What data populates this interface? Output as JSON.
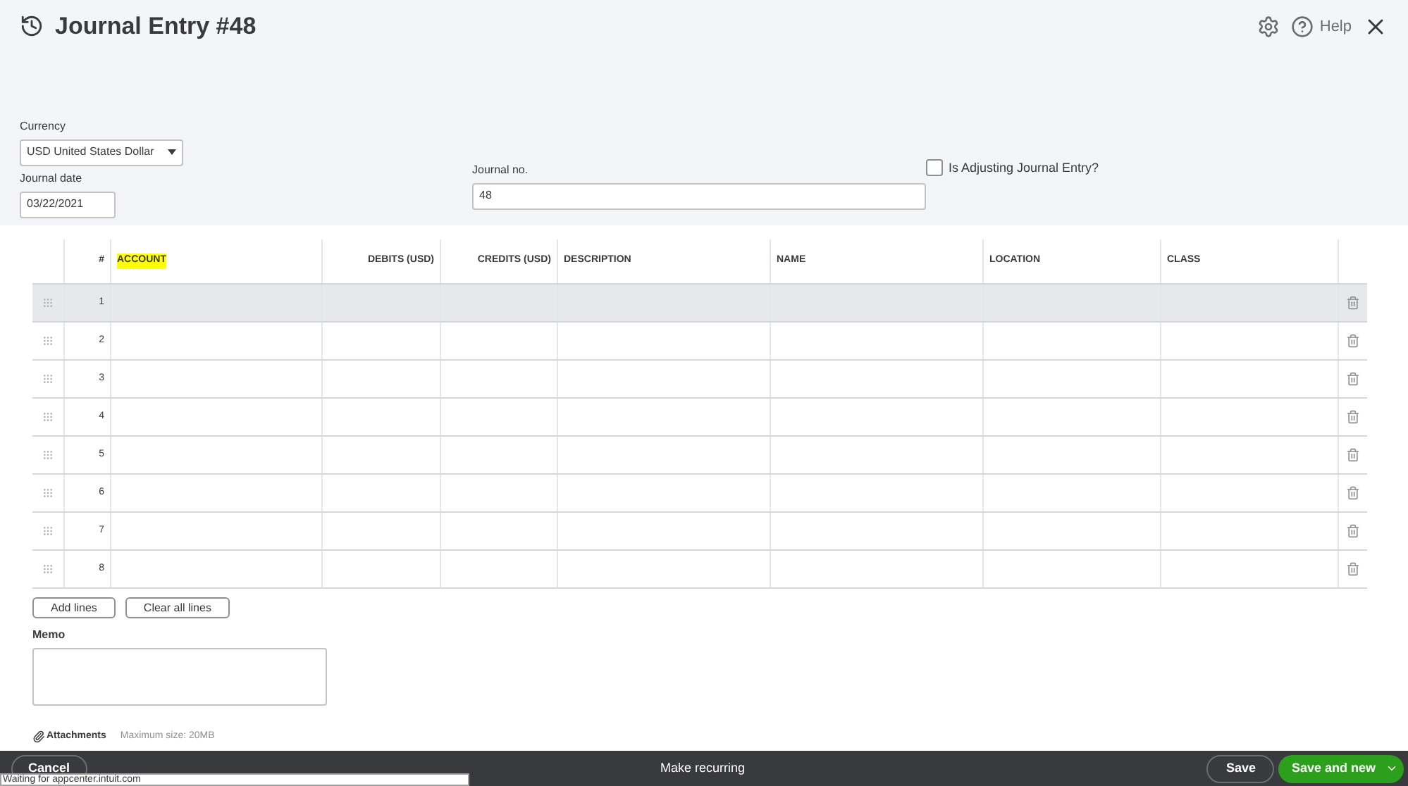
{
  "header": {
    "title": "Journal Entry #48",
    "help": "Help"
  },
  "form": {
    "currency_label": "Currency",
    "currency": "USD United States Dollar",
    "date_label": "Journal date",
    "date": "03/22/2021",
    "journal_no_label": "Journal no.",
    "journal_no": "48",
    "adjusting_label": "Is Adjusting Journal Entry?",
    "adjusting_checked": false
  },
  "table": {
    "columns": [
      {
        "label": "#",
        "highlight": false
      },
      {
        "label": "ACCOUNT",
        "highlight": true
      },
      {
        "label": "DEBITS (USD)",
        "highlight": false
      },
      {
        "label": "CREDITS (USD)",
        "highlight": false
      },
      {
        "label": "DESCRIPTION",
        "highlight": false
      },
      {
        "label": "NAME",
        "highlight": false
      },
      {
        "label": "LOCATION",
        "highlight": false
      },
      {
        "label": "CLASS",
        "highlight": false
      }
    ],
    "rows": [
      {
        "number": "1",
        "selected": true
      },
      {
        "number": "2",
        "selected": false
      },
      {
        "number": "3",
        "selected": false
      },
      {
        "number": "4",
        "selected": false
      },
      {
        "number": "5",
        "selected": false
      },
      {
        "number": "6",
        "selected": false
      },
      {
        "number": "7",
        "selected": false
      },
      {
        "number": "8",
        "selected": false
      }
    ]
  },
  "buttons": [
    "Add lines",
    "Clear all lines"
  ],
  "memo_label": "Memo",
  "attachments": {
    "label": "Attachments",
    "note": "Maximum size: 20MB"
  },
  "footer": {
    "cancel": "Cancel",
    "recurring": "Make recurring",
    "save": "Save",
    "save_new": "Save and new"
  },
  "status": "Waiting for appcenter.intuit.com"
}
